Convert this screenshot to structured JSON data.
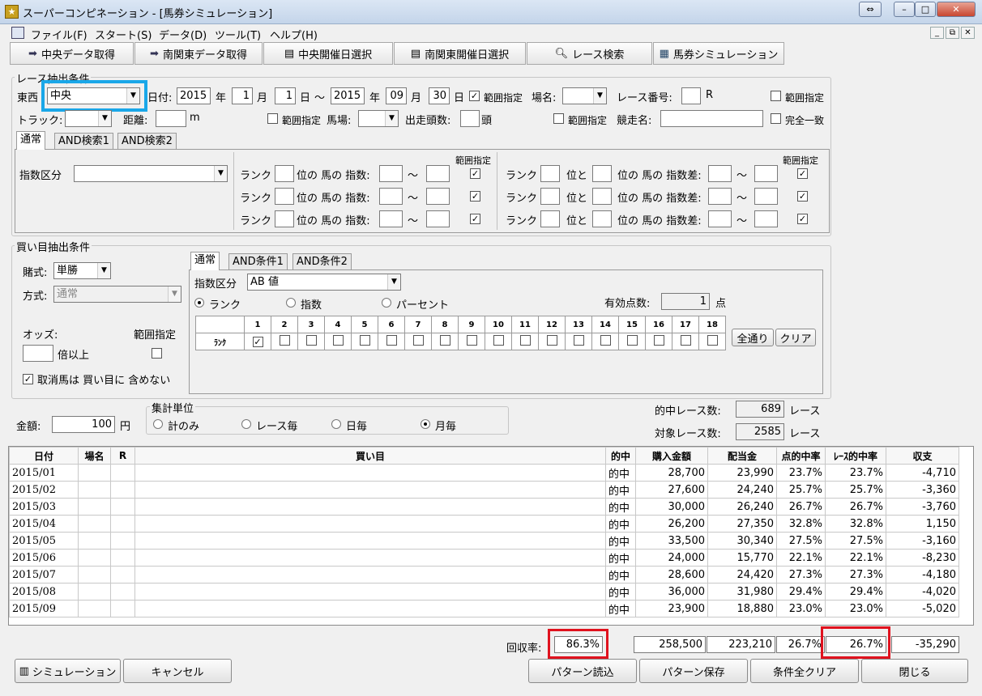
{
  "window": {
    "title": "スーパーコンピネーション - [馬券シミュレーション]",
    "icon": "app-logo-icon"
  },
  "menu": [
    "ファイル(F)",
    "スタート(S)",
    "データ(D)",
    "ツール(T)",
    "ヘルプ(H)"
  ],
  "toolbar": [
    {
      "label": "中央データ取得",
      "icon": "arrow-import-icon"
    },
    {
      "label": "南関東データ取得",
      "icon": "arrow-import-icon"
    },
    {
      "label": "中央開催日選択",
      "icon": "calendar-select-icon"
    },
    {
      "label": "南関東開催日選択",
      "icon": "calendar-select-icon"
    },
    {
      "label": "レース検索",
      "icon": "magnifier-icon"
    },
    {
      "label": "馬券シミュレーション",
      "icon": "table-grid-icon"
    }
  ],
  "race": {
    "group_title": "レース抽出条件",
    "tozai_label": "東西",
    "tozai_value": "中央",
    "date_label": "日付:",
    "from_year": "2015",
    "year_unit": "年",
    "from_month": "1",
    "month_unit": "月",
    "from_day": "1",
    "day_unit": "日",
    "wave": "～",
    "to_year": "2015",
    "to_month": "09",
    "to_day": "30",
    "range_label": "範囲指定",
    "place_label": "場名:",
    "race_no_label": "レース番号:",
    "race_unit": "R",
    "track_label": "トラック:",
    "distance_label": "距離:",
    "distance_unit": "m",
    "baba_label": "馬場:",
    "heads_label": "出走頭数:",
    "heads_unit": "頭",
    "race_name_label": "競走名:",
    "exact_label": "完全一致"
  },
  "race_tabs": [
    "通常",
    "AND検索1",
    "AND検索2"
  ],
  "index_section": {
    "index_kubun_label": "指数区分",
    "rank_label": "ランク",
    "left_mid": "位の 馬の 指数:",
    "right_mid1": "位と",
    "right_mid2": "位の 馬の 指数差:",
    "range_label": "範囲指定",
    "wave": "～"
  },
  "buy": {
    "group_title": "買い目抽出条件",
    "bet_label": "賭式:",
    "bet_value": "単勝",
    "method_label": "方式:",
    "method_value": "通常",
    "odds_label": "オッズ:",
    "range_label": "範囲指定",
    "odds_unit": "倍以上",
    "exclude_label": "取消馬は 買い目に 含めない"
  },
  "buy_tabs": [
    "通常",
    "AND条件1",
    "AND条件2"
  ],
  "buy_index": {
    "label": "指数区分",
    "value": "AB 値",
    "radios": [
      "ランク",
      "指数",
      "パーセント"
    ],
    "valid_label": "有効点数:",
    "valid_value": "1",
    "valid_unit": "点",
    "rank_row_label": "ﾗﾝｸ",
    "rank_cols": [
      "1",
      "2",
      "3",
      "4",
      "5",
      "6",
      "7",
      "8",
      "9",
      "10",
      "11",
      "12",
      "13",
      "14",
      "15",
      "16",
      "17",
      "18"
    ],
    "all_button": "全通り",
    "clear_button": "クリア"
  },
  "amount": {
    "label": "金額:",
    "value": "100",
    "unit": "円"
  },
  "aggregate": {
    "title": "集計単位",
    "options": [
      "計のみ",
      "レース毎",
      "日毎",
      "月毎"
    ],
    "selected": "月毎"
  },
  "stats": {
    "hit_label": "的中レース数:",
    "hit_value": "689",
    "target_label": "対象レース数:",
    "target_value": "2585",
    "unit": "レース"
  },
  "table": {
    "headers": [
      "日付",
      "場名",
      "R",
      "買い目",
      "的中",
      "購入金額",
      "配当金",
      "点的中率",
      "ﾚｰｽ的中率",
      "収支"
    ],
    "rows": [
      [
        "2015/01",
        "",
        "",
        "",
        "的中",
        "28,700",
        "23,990",
        "23.7%",
        "23.7%",
        "-4,710"
      ],
      [
        "2015/02",
        "",
        "",
        "",
        "的中",
        "27,600",
        "24,240",
        "25.7%",
        "25.7%",
        "-3,360"
      ],
      [
        "2015/03",
        "",
        "",
        "",
        "的中",
        "30,000",
        "26,240",
        "26.7%",
        "26.7%",
        "-3,760"
      ],
      [
        "2015/04",
        "",
        "",
        "",
        "的中",
        "26,200",
        "27,350",
        "32.8%",
        "32.8%",
        "1,150"
      ],
      [
        "2015/05",
        "",
        "",
        "",
        "的中",
        "33,500",
        "30,340",
        "27.5%",
        "27.5%",
        "-3,160"
      ],
      [
        "2015/06",
        "",
        "",
        "",
        "的中",
        "24,000",
        "15,770",
        "22.1%",
        "22.1%",
        "-8,230"
      ],
      [
        "2015/07",
        "",
        "",
        "",
        "的中",
        "28,600",
        "24,420",
        "27.3%",
        "27.3%",
        "-4,180"
      ],
      [
        "2015/08",
        "",
        "",
        "",
        "的中",
        "36,000",
        "31,980",
        "29.4%",
        "29.4%",
        "-4,020"
      ],
      [
        "2015/09",
        "",
        "",
        "",
        "的中",
        "23,900",
        "18,880",
        "23.0%",
        "23.0%",
        "-5,020"
      ]
    ]
  },
  "totals": {
    "recovery_label": "回収率:",
    "recovery_value": "86.3%",
    "purchase": "258,500",
    "payout": "223,210",
    "point_rate": "26.7%",
    "race_rate": "26.7%",
    "balance": "-35,290"
  },
  "buttons": {
    "simulate": "シミュレーション",
    "cancel": "キャンセル",
    "load": "パターン読込",
    "save": "パターン保存",
    "clear_all": "条件全クリア",
    "close": "閉じる"
  }
}
